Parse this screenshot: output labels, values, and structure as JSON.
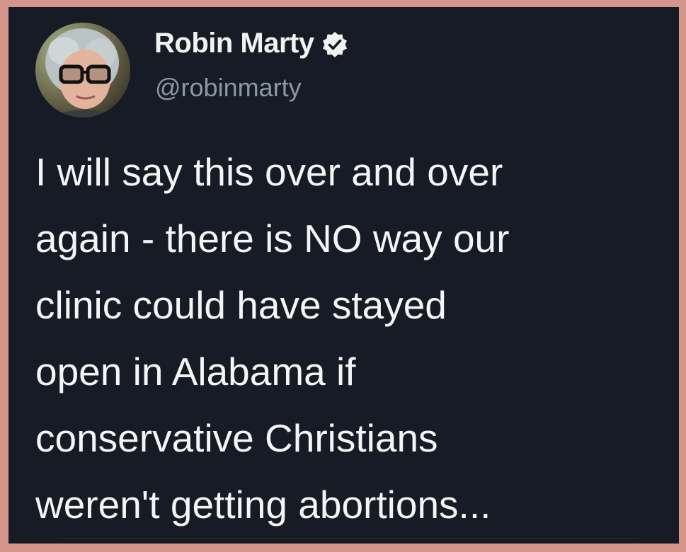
{
  "author": {
    "display_name": "Robin Marty",
    "handle": "@robinmarty",
    "verified_icon": "verified-badge-icon",
    "avatar_icon": "profile-photo"
  },
  "tweet": {
    "text": "I will say this over and over\nagain - there is NO way our\nclinic could have stayed\nopen in Alabama if\nconservative Christians\nweren't getting abortions..."
  },
  "colors": {
    "background": "#161b26",
    "frame": "#d4958a",
    "name_text": "#f2f2f2",
    "handle_text": "#8b98a5",
    "body_text": "#f5f5f5"
  }
}
